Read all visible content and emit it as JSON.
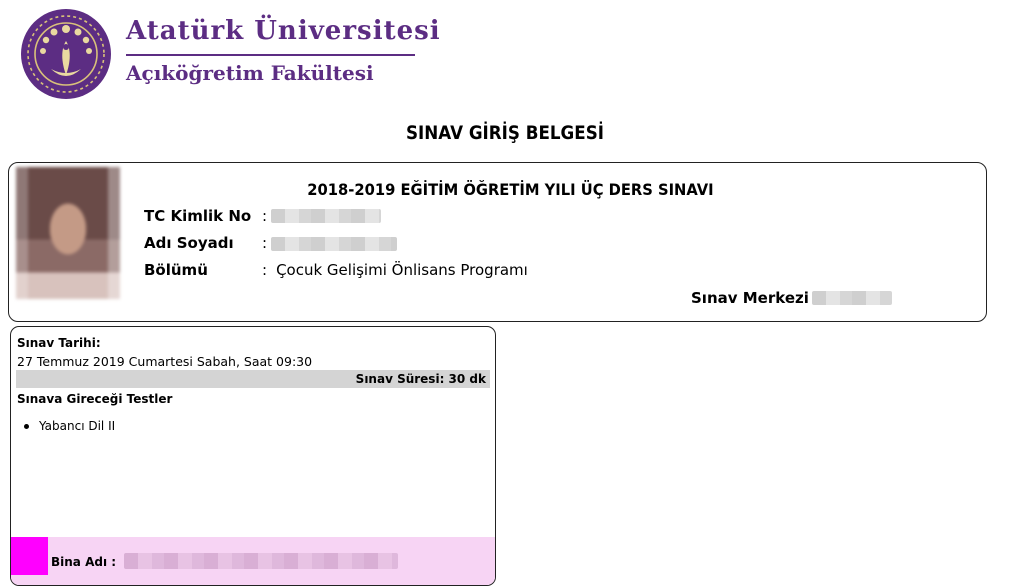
{
  "header": {
    "university": "Atatürk Üniversitesi",
    "faculty": "Açıköğretim Fakültesi"
  },
  "document": {
    "title": "SINAV GİRİŞ BELGESİ"
  },
  "student_card": {
    "term": "2018-2019 EĞİTİM ÖĞRETİM YILI ÜÇ DERS SINAVI",
    "fields": [
      {
        "label": "TC Kimlik No",
        "value": ""
      },
      {
        "label": "Adı Soyadı",
        "value": ""
      },
      {
        "label": "Bölümü",
        "value": "Çocuk Gelişimi Önlisans Programı"
      }
    ],
    "separator": ":",
    "exam_center_label": "Sınav Merkezi :"
  },
  "exam": {
    "date_label": "Sınav Tarihi:",
    "date_value": "27 Temmuz 2019 Cumartesi Sabah, Saat 09:30",
    "duration": "Sınav Süresi: 30 dk",
    "tests_label": "Sınava Gireceği Testler",
    "tests": [
      "Yabancı Dil II"
    ],
    "building_label": "Bina Adı :"
  },
  "colors": {
    "brand_purple": "#5c2d83",
    "building_highlight": "#f7d4f4",
    "marker_magenta": "#ff00ff",
    "duration_bar": "#d4d4d4"
  }
}
